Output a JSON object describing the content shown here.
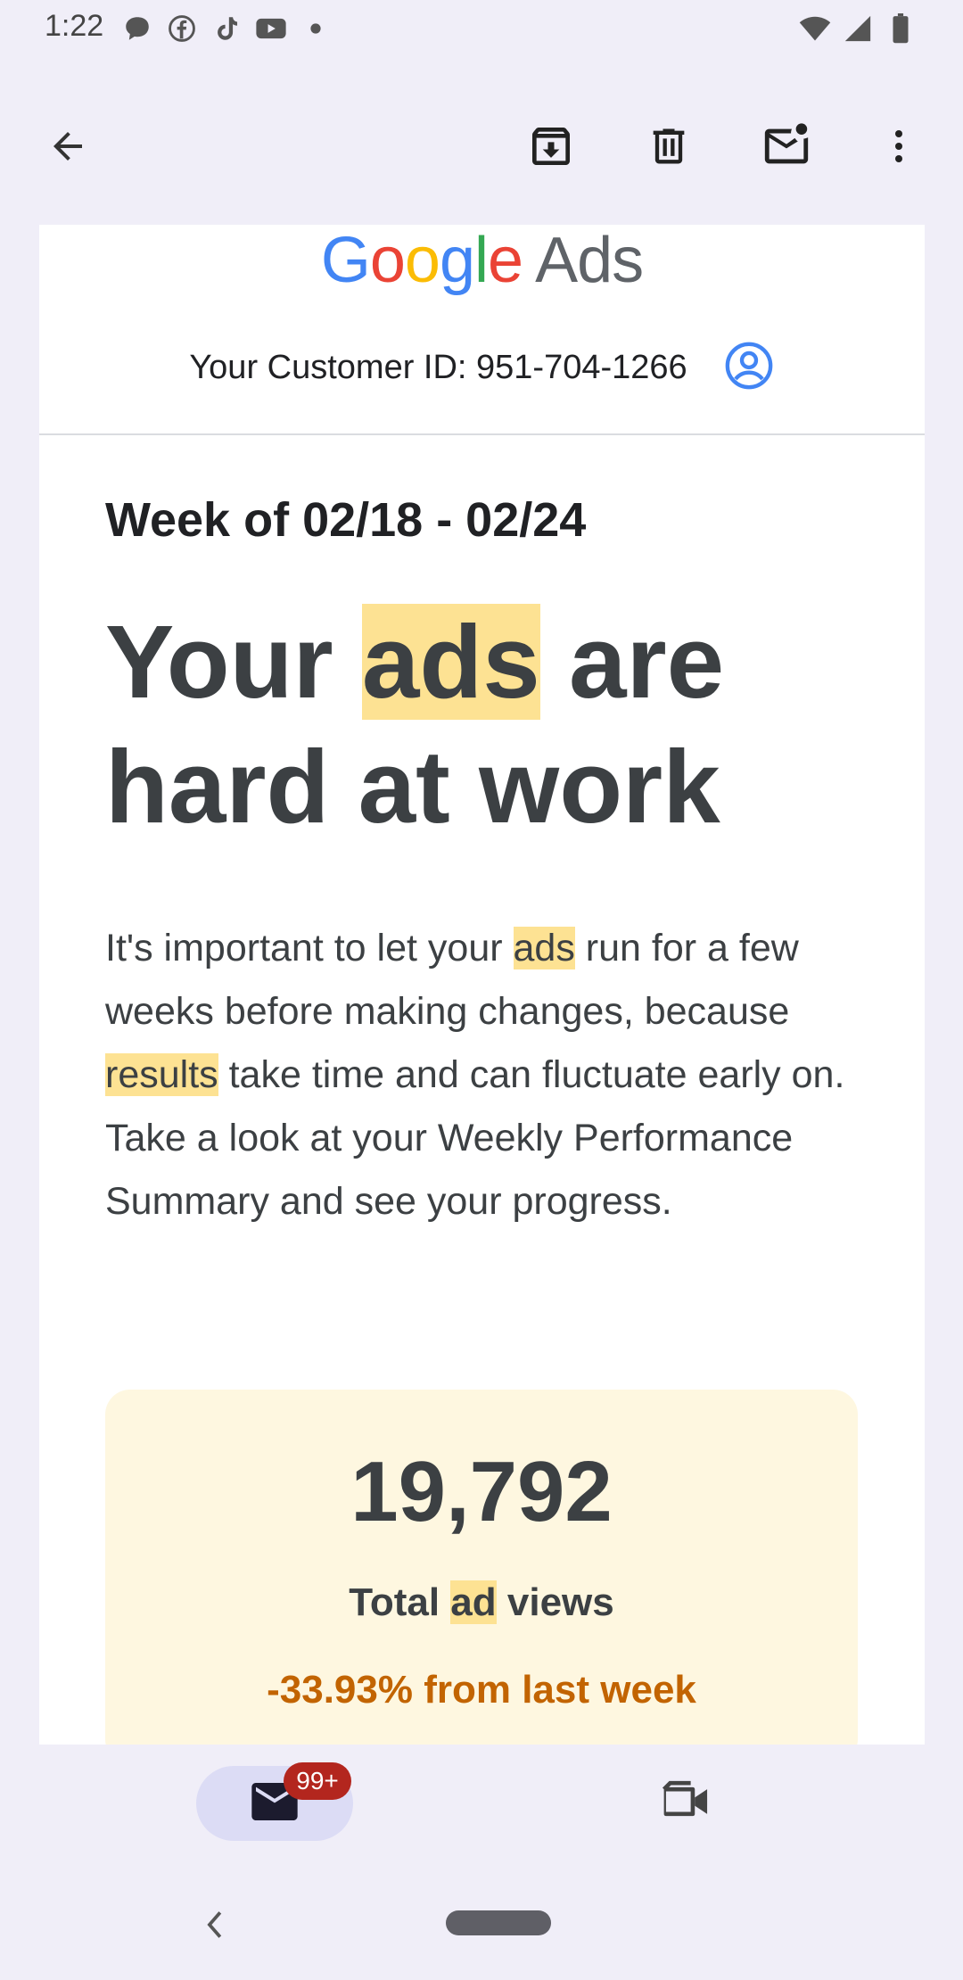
{
  "status_bar": {
    "time": "1:22",
    "left_icons": [
      "chat-bubble-icon",
      "facebook-icon",
      "tiktok-icon",
      "youtube-icon",
      "dot-icon"
    ],
    "right_icons": [
      "wifi-icon",
      "signal-icon",
      "battery-icon"
    ]
  },
  "toolbar": {
    "icons": [
      "back-arrow-icon",
      "archive-icon",
      "delete-icon",
      "mark-unread-icon",
      "more-vert-icon"
    ]
  },
  "email": {
    "logo": {
      "google": [
        "G",
        "o",
        "o",
        "g",
        "l",
        "e"
      ],
      "ads": "Ads"
    },
    "customer_id_text": "Your Customer ID: 951-704-1266",
    "week": "Week of 02/18 - 02/24",
    "headline": {
      "part1": "Your ",
      "highlight": "ads",
      "part2": " are hard at work"
    },
    "body": {
      "p1": "It's important to let your ",
      "h1": "ads",
      "p2": " run for a few weeks before making changes, because ",
      "h2": "results",
      "p3": " take time and can fluctuate early on. Take a look at your Weekly Performance Summary and see your progress."
    },
    "stat": {
      "value": "19,792",
      "label_pre": "Total ",
      "label_highlight": "ad",
      "label_post": " views",
      "change": "-33.93% from last week"
    }
  },
  "bottom_nav": {
    "mail_badge": "99+"
  },
  "colors": {
    "highlight": "#fde293",
    "stat_bg": "#fef7e0",
    "change_text": "#c26401",
    "badge": "#b3261e"
  }
}
